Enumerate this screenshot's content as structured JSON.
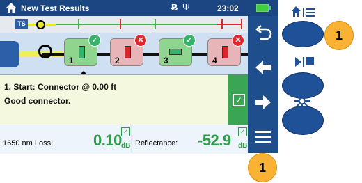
{
  "statusbar": {
    "title": "New Test Results",
    "bluetooth_glyph": "Ƀ",
    "usb_glyph": "Ψ",
    "time": "23:02",
    "icons": [
      "home-icon",
      "bluetooth-icon",
      "usb-icon",
      "battery-icon"
    ]
  },
  "trace_strip": {
    "badge": "TS"
  },
  "events": [
    {
      "number": "1",
      "status": "pass"
    },
    {
      "number": "2",
      "status": "fail"
    },
    {
      "number": "3",
      "status": "pass"
    },
    {
      "number": "4",
      "status": "fail"
    }
  ],
  "details": {
    "line1": "1. Start: Connector @ 0.00 ft",
    "line2": "Good connector."
  },
  "measurements": {
    "loss_label": "1650 nm Loss:",
    "loss_value": "0.10",
    "loss_unit": "dB",
    "reflectance_label": "Reflectance:",
    "reflectance_value": "-52.9",
    "reflectance_unit": "dB"
  },
  "softkeys": [
    "back-icon",
    "arrow-left-icon",
    "arrow-right-icon",
    "menu-icon"
  ],
  "hardware_buttons": [
    "home-menu-icon",
    "play-pause-icon",
    "laser-icon"
  ],
  "callouts": {
    "right": "1",
    "bottom": "1"
  },
  "colors": {
    "screen_blue": "#1f4e8c",
    "pass_green": "#2e9e48",
    "fail_red": "#d9262c",
    "callout_orange": "#f9b233"
  }
}
